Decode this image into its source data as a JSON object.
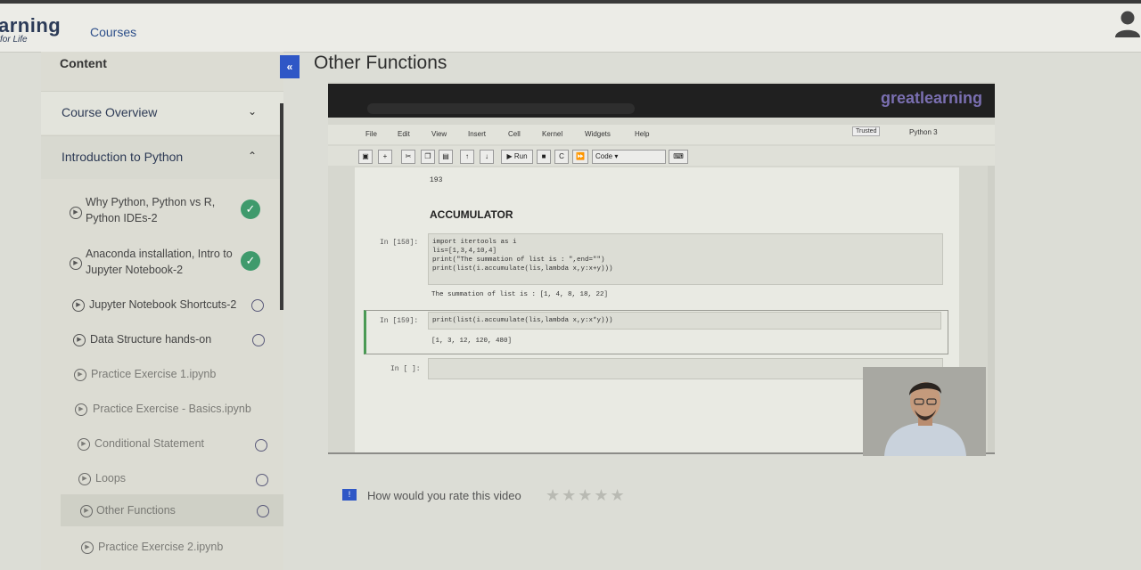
{
  "brand": {
    "line1": "arning",
    "line2": "for Life"
  },
  "nav": {
    "courses": "Courses"
  },
  "sidebar": {
    "content_label": "Content",
    "sections": [
      {
        "label": "Course Overview",
        "state": "collapsed"
      },
      {
        "label": "Introduction to Python",
        "state": "expanded"
      }
    ],
    "lessons": [
      {
        "title": "Why Python, Python vs R, Python IDEs-2",
        "status": "completed"
      },
      {
        "title": "Anaconda installation, Intro to Jupyter Notebook-2",
        "status": "completed"
      },
      {
        "title": "Jupyter Notebook Shortcuts-2",
        "status": "incomplete"
      },
      {
        "title": "Data Structure hands-on",
        "status": "incomplete"
      },
      {
        "title": "Practice Exercise 1.ipynb",
        "status": "none"
      },
      {
        "title": "Practice Exercise - Basics.ipynb",
        "status": "none"
      },
      {
        "title": "Conditional Statement",
        "status": "incomplete"
      },
      {
        "title": "Loops",
        "status": "incomplete"
      },
      {
        "title": "Other Functions",
        "status": "incomplete",
        "active": true
      },
      {
        "title": "Practice Exercise 2.ipynb",
        "status": "none"
      }
    ]
  },
  "main": {
    "collapse_label": "«",
    "title": "Other Functions"
  },
  "video": {
    "brand": "greatlearning",
    "jupyter": {
      "menu": [
        "File",
        "Edit",
        "View",
        "Insert",
        "Cell",
        "Kernel",
        "Widgets",
        "Help"
      ],
      "trusted": "Trusted",
      "kernel": "Python 3",
      "toolbar": {
        "run": "Run",
        "cell_type": "Code"
      },
      "output_prev": "193",
      "heading": "ACCUMULATOR",
      "cell1": {
        "prompt": "In [158]:",
        "code": "import itertools as i\nlis=[1,3,4,10,4]\nprint(\"The summation of list is : \",end=\"\")\nprint(list(i.accumulate(lis,lambda x,y:x+y)))",
        "output": "The summation of list is : [1, 4, 8, 18, 22]"
      },
      "cell2": {
        "prompt": "In [159]:",
        "code": "print(list(i.accumulate(lis,lambda x,y:x*y)))",
        "output": "[1, 3, 12, 120, 480]"
      },
      "cell3": {
        "prompt": "In [ ]:"
      }
    }
  },
  "rating": {
    "badge": "!",
    "question": "How would you rate this video",
    "stars": "★★★★★",
    "value": 0,
    "max": 5
  }
}
